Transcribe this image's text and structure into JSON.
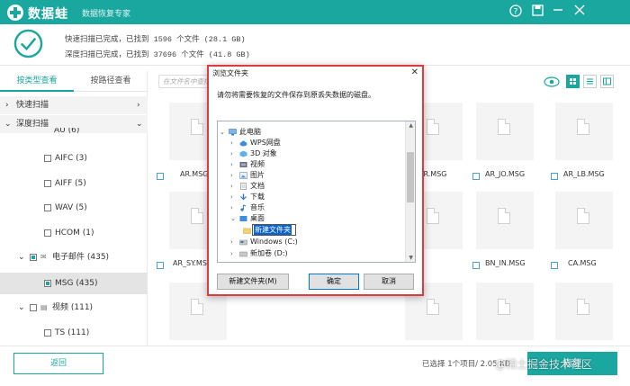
{
  "app": {
    "name": "数据蛙",
    "subtitle": "数据恢复专家",
    "help_icon": "help-icon",
    "save_icon": "save-icon",
    "minimize_icon": "minimize-icon",
    "close_icon": "close-icon",
    "accent_color": "#1aa7a0"
  },
  "summary": {
    "quick_scan": "快速扫描已完成，已找到  1596  个文件  (28.1 GB)",
    "deep_scan": "深度扫描已完成，已找到 37696  个文件  (41.8 GB)"
  },
  "sidebar": {
    "tabs": [
      "按类型查看",
      "按路径查看"
    ],
    "items": [
      {
        "label": "快速扫描",
        "kind": "category"
      },
      {
        "label": "深度扫描",
        "kind": "category"
      },
      {
        "label": "AU (6)",
        "kind": "type"
      },
      {
        "label": "AIFC (3)",
        "kind": "type"
      },
      {
        "label": "AIFF (5)",
        "kind": "type"
      },
      {
        "label": "WAV (5)",
        "kind": "type"
      },
      {
        "label": "HCOM (1)",
        "kind": "type"
      },
      {
        "label": "电子邮件 (435)",
        "kind": "group"
      },
      {
        "label": "MSG (435)",
        "kind": "type"
      },
      {
        "label": "视频 (111)",
        "kind": "group"
      },
      {
        "label": "TS (111)",
        "kind": "type"
      }
    ]
  },
  "search": {
    "placeholder": "在文件名中查找"
  },
  "files": {
    "row1": [
      "AR.MSG",
      "",
      "",
      "AR.MSG",
      "AR_JO.MSG",
      "AR_LB.MSG"
    ],
    "row2": [
      "AR_SY.MSG",
      "",
      "",
      "",
      "BN_IN.MSG",
      "CA.MSG"
    ]
  },
  "dialog": {
    "title": "浏览文件夹",
    "message": "请勿将需要恢复的文件保存到原丢失数据的磁盘。",
    "tree": [
      "此电脑",
      "WPS网盘",
      "3D 对象",
      "视频",
      "图片",
      "文档",
      "下载",
      "音乐",
      "桌面",
      "新建文件夹",
      "Windows (C:)",
      "新加卷 (D:)"
    ],
    "new_folder_label": "新建文件夹(M)",
    "ok_label": "确定",
    "cancel_label": "取消"
  },
  "bottom": {
    "back_label": "返回",
    "status": "已选择 1个项目/ 2.05 KB",
    "recover_label": "恢复",
    "watermark": "@稀土掘金技术社区"
  }
}
